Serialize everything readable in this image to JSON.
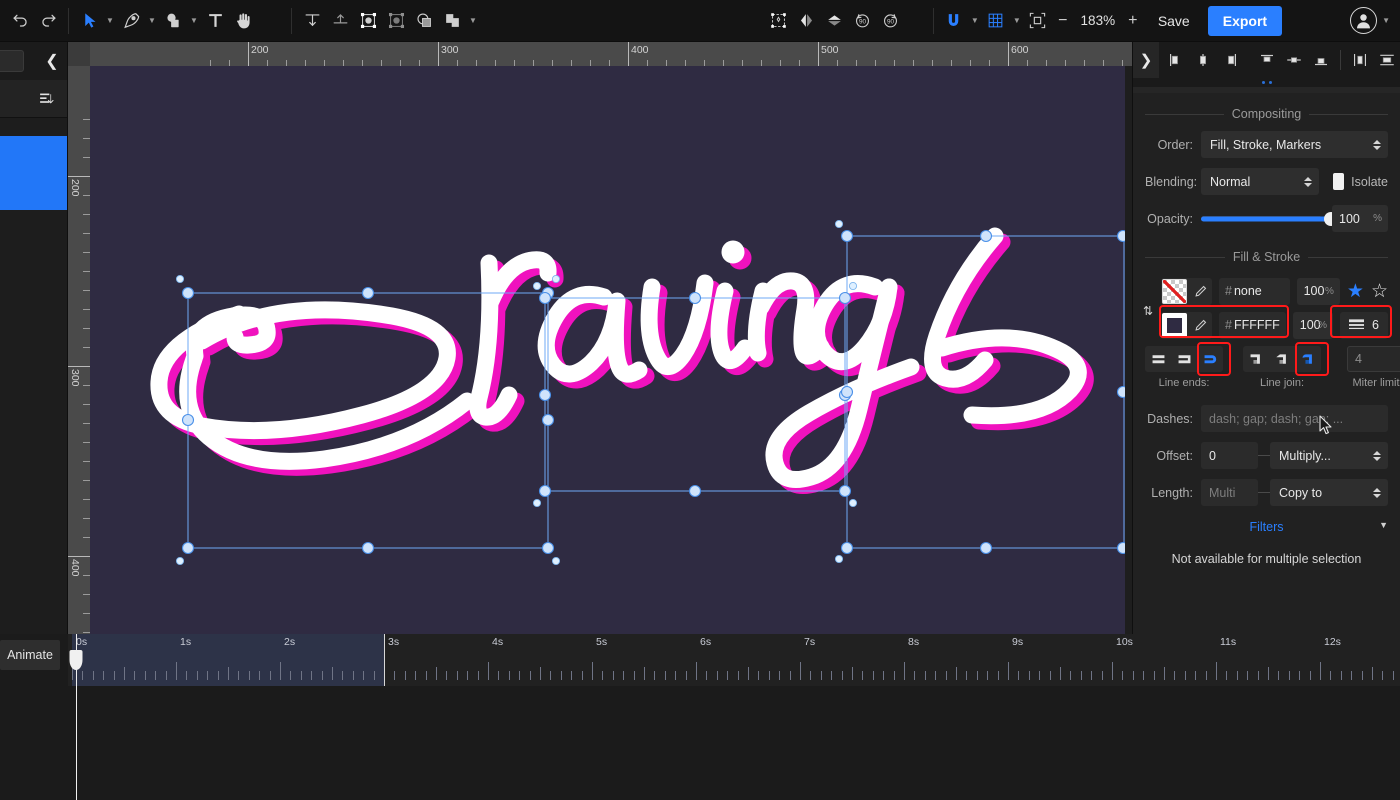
{
  "app": {
    "zoom_level": "183%",
    "save_label": "Save",
    "export_label": "Export"
  },
  "toolbar": {
    "undo_icon": "undo-icon",
    "redo_icon": "redo-icon",
    "tools": [
      {
        "name": "select-tool",
        "icon": "cursor-arrow-icon",
        "has_caret": true
      },
      {
        "name": "pen-tool",
        "icon": "pen-nib-icon",
        "has_caret": true
      },
      {
        "name": "shape-tool",
        "icon": "shapes-icon",
        "has_caret": true
      },
      {
        "name": "text-tool",
        "icon": "text-t-icon",
        "has_caret": false
      },
      {
        "name": "hand-tool",
        "icon": "hand-icon",
        "has_caret": false
      }
    ],
    "align_tools": [
      {
        "name": "align-to-bottom",
        "icon": "align-bottom-icon"
      },
      {
        "name": "align-to-axis",
        "icon": "align-axis-icon"
      },
      {
        "name": "fit-to-selection",
        "icon": "fit-selection-icon"
      },
      {
        "name": "fit-to-group",
        "icon": "fit-group-icon"
      },
      {
        "name": "boolean-op",
        "icon": "boolean-shape-icon"
      },
      {
        "name": "arrange-order",
        "icon": "arrange-layers-icon",
        "has_caret": true
      }
    ],
    "transform_tools": [
      {
        "name": "transform-center",
        "icon": "transform-center-icon"
      },
      {
        "name": "flip-horizontal",
        "icon": "flip-horizontal-icon"
      },
      {
        "name": "flip-vertical",
        "icon": "flip-vertical-icon"
      },
      {
        "name": "rotate-ccw-90",
        "icon": "rotate-left-90-icon"
      },
      {
        "name": "rotate-cw-90",
        "icon": "rotate-right-90-icon"
      }
    ],
    "snap_icon": "magnet-snap-icon",
    "grid_icon": "grid-icon",
    "fit_icon": "fit-to-screen-icon",
    "zoom_out": "−",
    "zoom_in": "+"
  },
  "left_panel": {
    "collapse_icon": "chevron-left-icon",
    "sort_icon": "sort-layers-icon",
    "selected_layer_color": "#2277f8"
  },
  "canvas": {
    "background_color": "#2f2b42",
    "artwork_text": "Cravings",
    "artwork_fill": "#ffffff",
    "artwork_shadow": "#f012be",
    "ruler_horizontal_labels": [
      "200",
      "300",
      "400",
      "500",
      "600"
    ],
    "ruler_vertical_labels": [
      "200",
      "300",
      "400"
    ],
    "selection_color": "#6fa8f5"
  },
  "right_panel": {
    "expand_icon": "chevron-right-icon",
    "align_icons": [
      {
        "name": "align-left",
        "icon": "align-left-icon"
      },
      {
        "name": "align-center-horizontal",
        "icon": "align-center-h-icon"
      },
      {
        "name": "align-right",
        "icon": "align-right-icon"
      },
      {
        "name": "align-top",
        "icon": "align-top-icon"
      },
      {
        "name": "align-middle-vertical",
        "icon": "align-middle-v-icon"
      },
      {
        "name": "align-bottom",
        "icon": "align-bottom-icon"
      },
      {
        "name": "distribute-horizontal",
        "icon": "distribute-h-icon"
      },
      {
        "name": "distribute-vertical",
        "icon": "distribute-v-icon"
      }
    ],
    "compositing": {
      "title": "Compositing",
      "order_label": "Order:",
      "order_value": "Fill, Stroke, Markers",
      "blending_label": "Blending:",
      "blending_value": "Normal",
      "isolate_label": "Isolate",
      "opacity_label": "Opacity:",
      "opacity_value": "100",
      "opacity_unit": "%",
      "opacity_percent": 100
    },
    "fill_stroke": {
      "title": "Fill & Stroke",
      "fill": {
        "swatch": "none",
        "hex_hash": "#",
        "hex_value": "none",
        "alpha": "100",
        "alpha_unit": "%"
      },
      "stroke": {
        "swatch": "solid",
        "hex_hash": "#",
        "hex_value": "FFFFFF",
        "alpha": "100",
        "alpha_unit": "%",
        "width": "6"
      },
      "swap_icon": "swap-fill-stroke-icon",
      "star_filled_icon": "star-filled-icon",
      "star_empty_icon": "star-outline-icon",
      "line_ends_label": "Line ends:",
      "line_ends": [
        {
          "name": "cap-butt",
          "icon": "cap-butt-icon",
          "selected": false
        },
        {
          "name": "cap-square",
          "icon": "cap-square-icon",
          "selected": false
        },
        {
          "name": "cap-round",
          "icon": "cap-round-icon",
          "selected": true
        }
      ],
      "line_join_label": "Line join:",
      "line_joins": [
        {
          "name": "join-miter",
          "icon": "join-miter-icon",
          "selected": false
        },
        {
          "name": "join-bevel",
          "icon": "join-bevel-icon",
          "selected": false
        },
        {
          "name": "join-round",
          "icon": "join-round-icon",
          "selected": true
        }
      ],
      "miter_limit_value": "4",
      "miter_limit_label": "Miter limit",
      "dashes_label": "Dashes:",
      "dashes_placeholder": "dash; gap; dash; gap; ...",
      "offset_label": "Offset:",
      "offset_value": "0",
      "multiply_value": "Multiply...",
      "length_label": "Length:",
      "length_value": "Multi",
      "copy_to_value": "Copy to"
    },
    "filters": {
      "title": "Filters",
      "note": "Not available for multiple selection",
      "chevron_icon": "chevron-down-icon",
      "accent_color": "#2a7fff"
    },
    "highlight_color": "#ff1a1a"
  },
  "timeline": {
    "animate_label": "Animate",
    "labels": [
      "0s",
      "1s",
      "2s",
      "3s",
      "4s",
      "5s",
      "6s",
      "7s",
      "8s",
      "9s",
      "10s",
      "11s",
      "12s"
    ],
    "playhead_time": "0s",
    "selection_start": "0s",
    "selection_end": "3s",
    "seconds_per_label": 1,
    "total_seconds": 12.7
  }
}
